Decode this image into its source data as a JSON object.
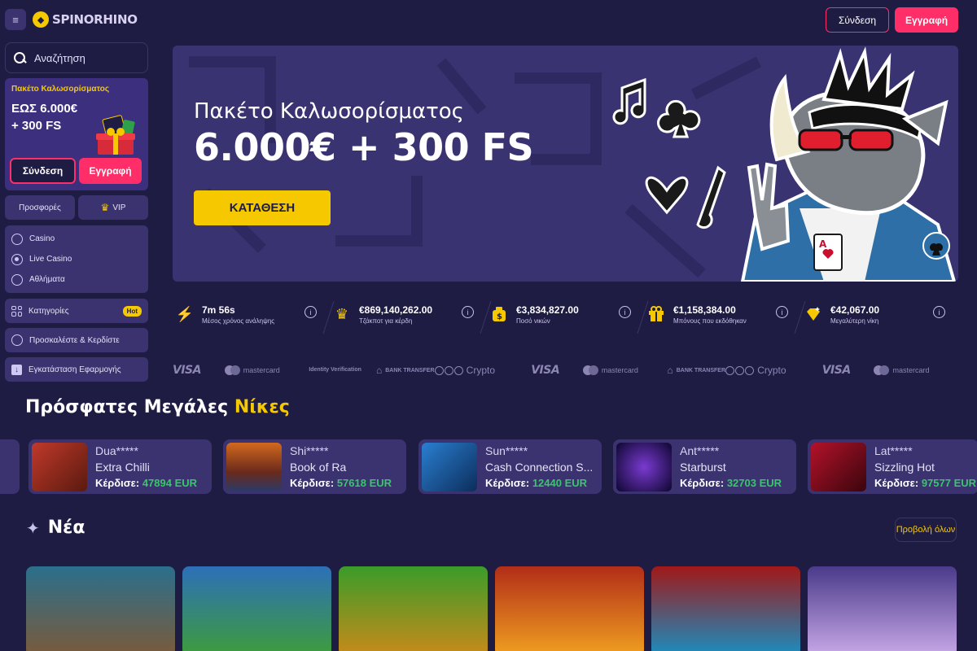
{
  "brand": {
    "name": "SPINORHINO"
  },
  "search": {
    "placeholder": "Αναζήτηση"
  },
  "sidebar": {
    "promo": {
      "title": "Πακέτο Καλωσορίσματος",
      "amount": "ΕΩΣ 6.000€\n+ 300 FS",
      "login": "Σύνδεση",
      "register": "Εγγραφή"
    },
    "promotions": "Προσφορές",
    "vip": "VIP",
    "nav": [
      {
        "label": "Casino",
        "icon": "casino-icon"
      },
      {
        "label": "Live Casino",
        "icon": "live-casino-icon"
      },
      {
        "label": "Αθλήματα",
        "icon": "sports-icon"
      }
    ],
    "categories": "Κατηγορίες",
    "hot": "Hot",
    "invite": "Προσκαλέστε & Κερδίστε",
    "install": "Εγκατάσταση Εφαρμογής"
  },
  "header": {
    "login": "Σύνδεση",
    "register": "Εγγραφή"
  },
  "hero": {
    "subtitle": "Πακέτο Καλωσορίσματος",
    "title": "6.000€ + 300 FS",
    "cta": "ΚΑΤΑΘΕΣΗ"
  },
  "stats": [
    {
      "value": "7m 56s",
      "label": "Μέσος χρόνος ανάληψης",
      "icon": "lightning-icon"
    },
    {
      "value": "€869,140,262.00",
      "label": "Τζάκποτ για κέρδη",
      "icon": "crown-icon"
    },
    {
      "value": "€3,834,827.00",
      "label": "Ποσό νικών",
      "icon": "money-bag-icon"
    },
    {
      "value": "€1,158,384.00",
      "label": "Μπόνους που εκδόθηκαν",
      "icon": "gift-icon"
    },
    {
      "value": "€42,067.00",
      "label": "Μεγαλύτερη νίκη",
      "icon": "diamond-icon"
    }
  ],
  "payments": {
    "visa": "VISA",
    "mastercard": "mastercard",
    "identity": "Identity Verification",
    "bank": "BANK TRANSFER",
    "crypto": "Crypto"
  },
  "recent_wins": {
    "title_a": "Πρόσφατες Μεγάλες",
    "title_b": "Νίκες",
    "won_label": "Κέρδισε:",
    "items": [
      {
        "user": "Dua*****",
        "game": "Extra Chilli",
        "amount": "47894 EUR",
        "colors": [
          "#c0392b",
          "#5a1a0e"
        ]
      },
      {
        "user": "Shi*****",
        "game": "Book of Ra",
        "amount": "57618 EUR",
        "colors": [
          "#6a2a1a",
          "#d2691e"
        ]
      },
      {
        "user": "Sun*****",
        "game": "Cash Connection S...",
        "amount": "12440 EUR",
        "colors": [
          "#2a7fd0",
          "#0c2d5c"
        ]
      },
      {
        "user": "Ant*****",
        "game": "Starburst",
        "amount": "32703 EUR",
        "colors": [
          "#3b1a7a",
          "#0d0630"
        ]
      },
      {
        "user": "Lat*****",
        "game": "Sizzling Hot",
        "amount": "97577 EUR",
        "colors": [
          "#b3122a",
          "#3a050c"
        ]
      }
    ]
  },
  "new_games": {
    "title": "Νέα",
    "view_all": "Προβολή όλων",
    "tiles": [
      {
        "name": "robot-game",
        "colors": [
          "#2b6f8c",
          "#7a5a3a"
        ]
      },
      {
        "name": "leprechaun-1000-game",
        "colors": [
          "#2d6fb8",
          "#3e9c3a"
        ]
      },
      {
        "name": "leprechaun-coins-game",
        "colors": [
          "#3a9c2a",
          "#c88a1a"
        ]
      },
      {
        "name": "egypt-game",
        "colors": [
          "#b22d18",
          "#f0a020"
        ]
      },
      {
        "name": "gems-game",
        "colors": [
          "#a01818",
          "#1a8ec0"
        ]
      },
      {
        "name": "anime-game",
        "colors": [
          "#4a3a8a",
          "#c8a8e8"
        ]
      }
    ]
  }
}
